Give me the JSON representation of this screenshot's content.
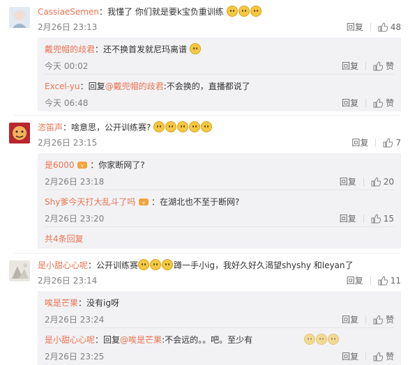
{
  "comments": [
    {
      "user": "CassiaeSemen",
      "text": "我懂了 你们就是要k宝负重训练",
      "date": "2月26日 23:13",
      "reply_label": "回复",
      "likes": "48",
      "replies": [
        {
          "user": "戴兜帽的歧君",
          "text": "还不换首发就尼玛离谱",
          "date": "今天 00:02",
          "reply_label": "回复",
          "likes": "赞"
        },
        {
          "user": "Excel-yu",
          "prefix": "回复",
          "mention": "@戴兜帽的歧君",
          "text": ":不会换的，直播都说了",
          "date": "今天 06:48",
          "reply_label": "回复",
          "likes": "赞"
        }
      ]
    },
    {
      "user": "恣笛声",
      "text": "啥意思，公开训练赛?",
      "date": "2月26日 23:15",
      "reply_label": "回复",
      "likes": "7",
      "replies": [
        {
          "user": "是6000",
          "text": "你家断网了?",
          "date": "2月26日 23:18",
          "reply_label": "回复",
          "likes": "20"
        },
        {
          "user": "Shy爹今天打大乱斗了吗",
          "text": "在湖北也不至于断网?",
          "date": "2月26日 23:20",
          "reply_label": "回复",
          "likes": "15"
        }
      ],
      "more": "共4条回复"
    },
    {
      "user": "是小甜心心呢",
      "text_a": "公开训练赛",
      "text_b": "蹲一手小ig，我好久好久渴望shyshy 和leyan了",
      "date": "2月26日 23:14",
      "reply_label": "回复",
      "likes": "11",
      "replies": [
        {
          "user": "唉是芒果",
          "text": "没有ig呀",
          "date": "2月26日 23:24",
          "reply_label": "回复",
          "likes": "赞"
        },
        {
          "user": "是小甜心心呢",
          "prefix": "回复",
          "mention": "@唉是芒果",
          "text": ":不会远的。。吧。至少有",
          "date": "2月26日 23:25",
          "reply_label": "回复",
          "likes": "赞"
        }
      ]
    }
  ],
  "colors": {
    "username": "#eb7350",
    "reply_bg": "#f2f2f5",
    "meta": "#808080"
  }
}
